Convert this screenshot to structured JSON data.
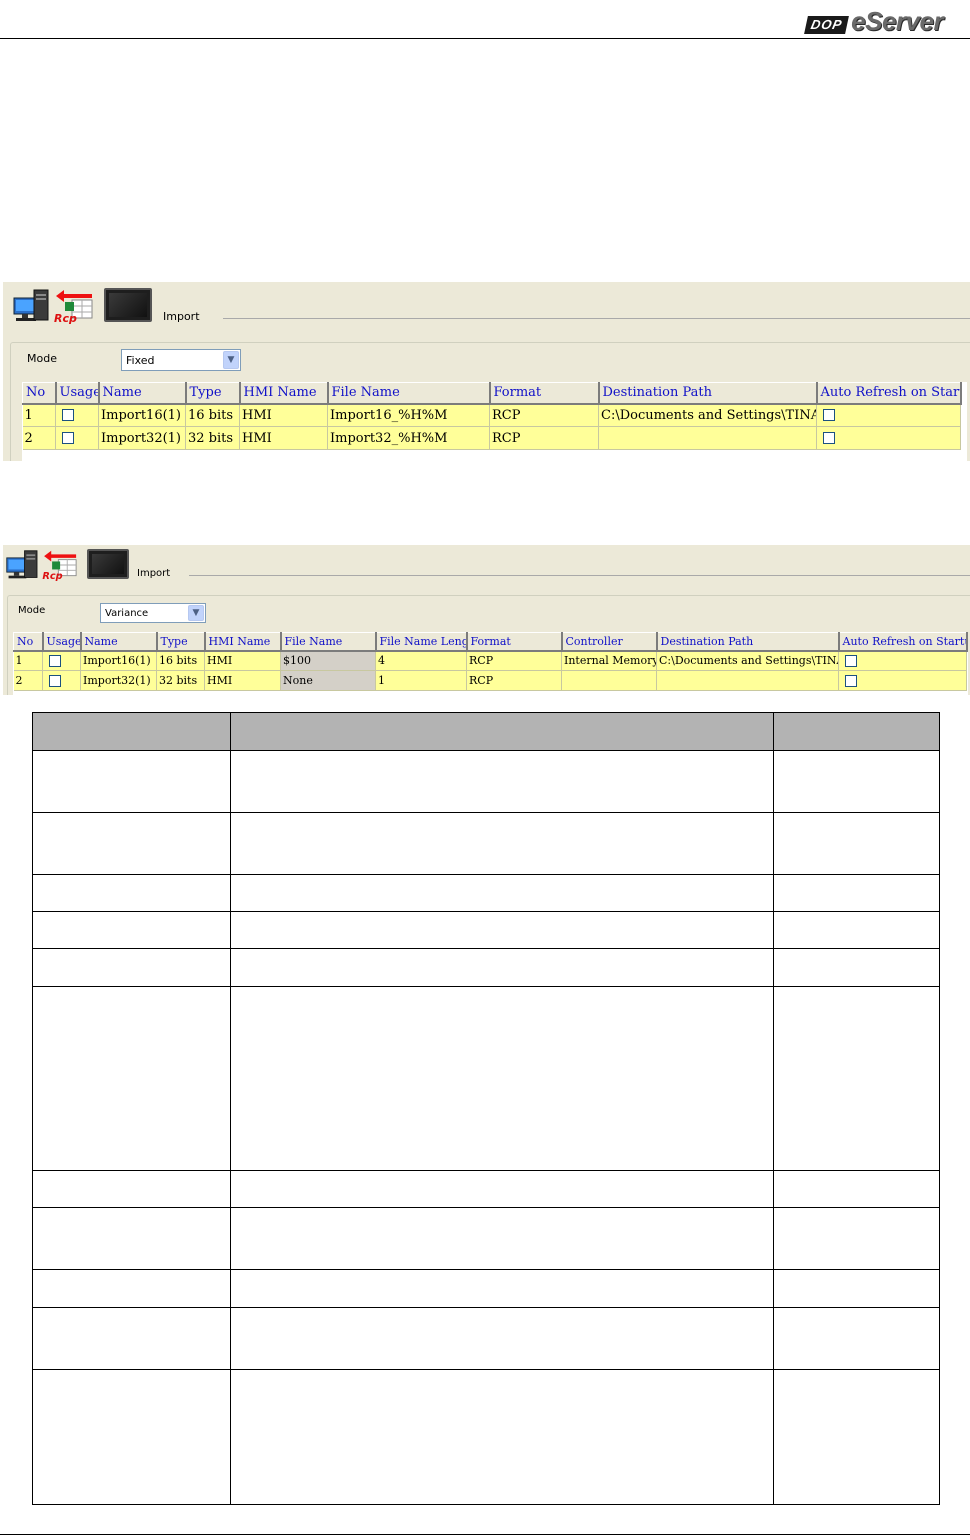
{
  "header": {
    "logo_badge": "DOP",
    "logo_text": "eServer"
  },
  "panel_fixed": {
    "import_label": "Import",
    "mode_label": "Mode",
    "mode_value": "Fixed",
    "columns": [
      "No",
      "Usage",
      "Name",
      "Type",
      "HMI Name",
      "File Name",
      "Format",
      "Destination Path",
      "Auto Refresh on Startup"
    ],
    "rows": [
      {
        "no": "1",
        "name": "Import16(1)",
        "type": "16 bits",
        "hmi": "HMI",
        "file": "Import16_%H%M",
        "format": "RCP",
        "dest": "C:\\Documents and Settings\\TINA.Q.LEE"
      },
      {
        "no": "2",
        "name": "Import32(1)",
        "type": "32 bits",
        "hmi": "HMI",
        "file": "Import32_%H%M",
        "format": "RCP",
        "dest": ""
      }
    ]
  },
  "panel_variance": {
    "import_label": "Import",
    "mode_label": "Mode",
    "mode_value": "Variance",
    "columns": [
      "No",
      "Usage",
      "Name",
      "Type",
      "HMI Name",
      "File Name",
      "File Name Length",
      "Format",
      "Controller",
      "Destination Path",
      "Auto Refresh on Startup"
    ],
    "rows": [
      {
        "no": "1",
        "name": "Import16(1)",
        "type": "16 bits",
        "hmi": "HMI",
        "file": "$100",
        "length": "4",
        "format": "RCP",
        "controller": "Internal Memory",
        "dest": "C:\\Documents and Settings\\TINA.Q.L"
      },
      {
        "no": "2",
        "name": "Import32(1)",
        "type": "32 bits",
        "hmi": "HMI",
        "file": "None",
        "length": "1",
        "format": "RCP",
        "controller": "",
        "dest": ""
      }
    ]
  },
  "colors": {
    "grid_row": "#ffff99",
    "grid_header_text": "#1010c8",
    "panel_bg": "#ece9d8",
    "spec_header": "#b3b3b3"
  }
}
